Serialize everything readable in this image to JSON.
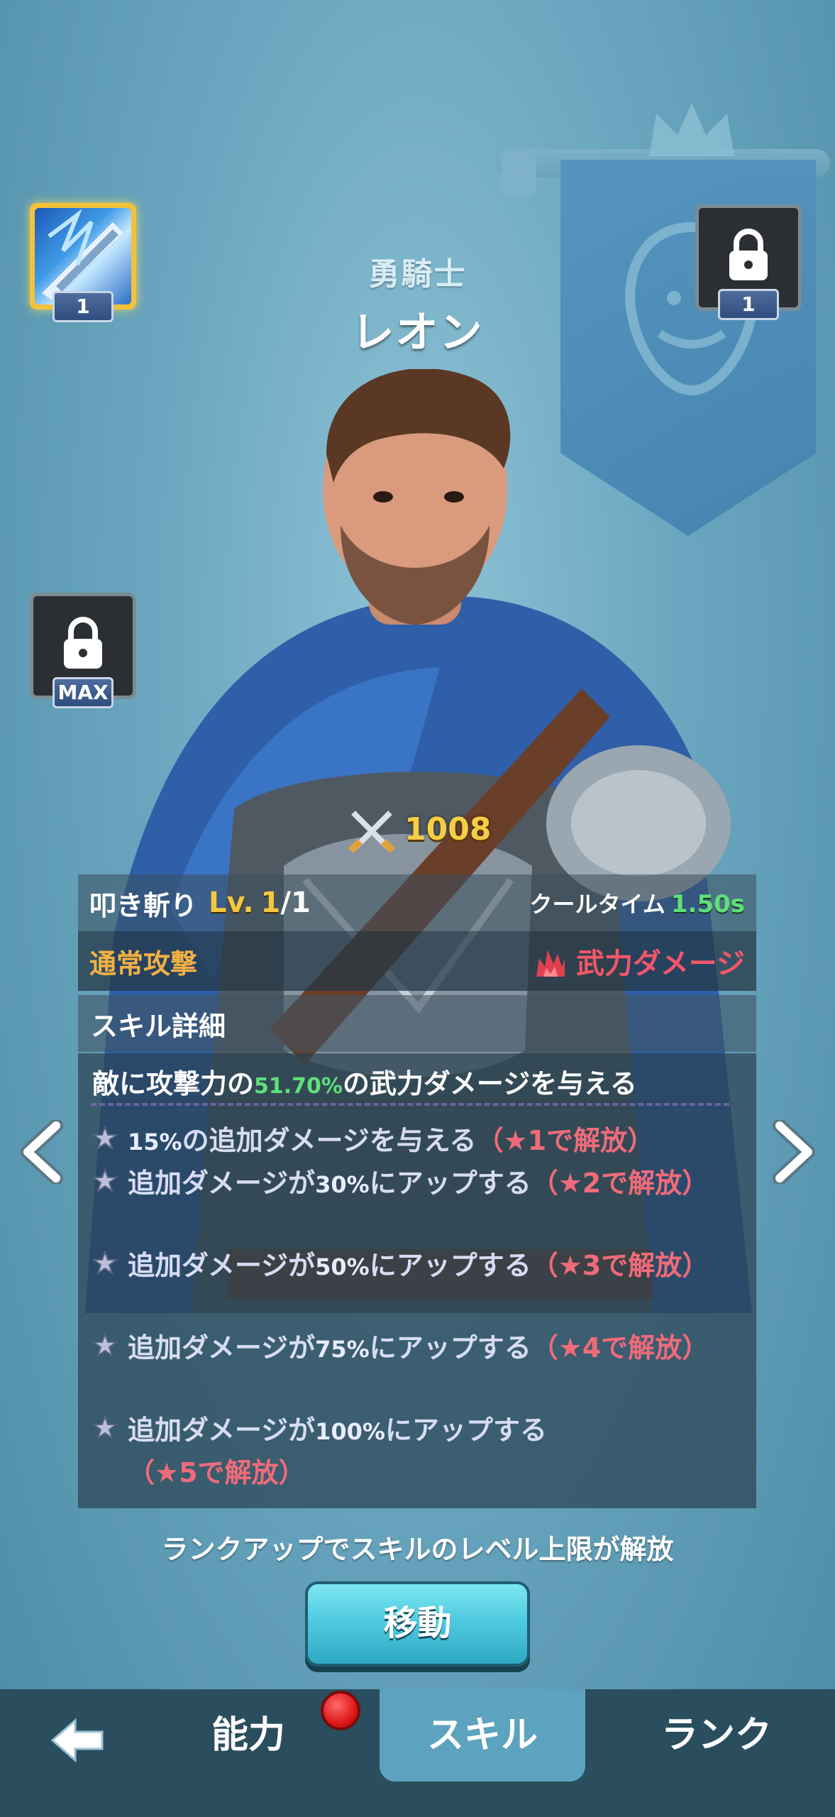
{
  "hero": {
    "class": "勇騎士",
    "name": "レオン",
    "power": "1008"
  },
  "skill_slots": [
    {
      "level": "1",
      "state": "selected"
    },
    {
      "level": "1",
      "state": "locked"
    },
    {
      "level": "MAX",
      "state": "locked"
    }
  ],
  "skill": {
    "name": "叩き斬り",
    "level_prefix": "Lv.",
    "level": "1",
    "level_max": "/1",
    "cooldown_label": "クールタイム",
    "cooldown_value": "1.50s",
    "attack_type": "通常攻撃",
    "damage_type": "武力ダメージ",
    "detail_title": "スキル詳細",
    "description_prefix": "敵に攻撃力の",
    "description_pct": "51.70%",
    "description_suffix": "の武力ダメージを与える",
    "effects": [
      {
        "pre": "",
        "pct": "15%",
        "post": "の追加ダメージを与える",
        "unlock": "（★1で解放）"
      },
      {
        "pre": "追加ダメージが",
        "pct": "30%",
        "post": "にアップする",
        "unlock": "（★2で解放）"
      },
      {
        "pre": "追加ダメージが",
        "pct": "50%",
        "post": "にアップする",
        "unlock": "（★3で解放）"
      },
      {
        "pre": "追加ダメージが",
        "pct": "75%",
        "post": "にアップする",
        "unlock": "（★4で解放）"
      },
      {
        "pre": "追加ダメージが",
        "pct": "100%",
        "post": "にアップする",
        "unlock": "（★5で解放）"
      }
    ]
  },
  "note": "ランクアップでスキルのレベル上限が解放",
  "move_button": "移動",
  "nav": {
    "ability": "能力",
    "skill": "スキル",
    "rank": "ランク"
  },
  "colors": {
    "accent_gold": "#f4c73f",
    "accent_green": "#5ee07a",
    "damage_red": "#f4566a",
    "attack_orange": "#f3b043",
    "unlock_pink": "#f06b7a"
  }
}
